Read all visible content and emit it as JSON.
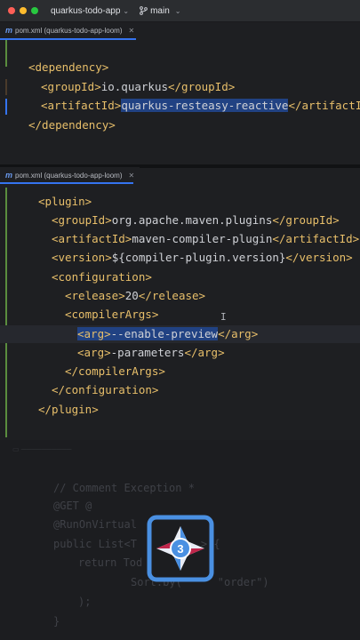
{
  "window": {
    "project": "quarkus-todo-app",
    "branch": "main",
    "traffic_lights": [
      "#ff5f57",
      "#febc2e",
      "#28c840"
    ]
  },
  "pane1": {
    "tab_label": "pom.xml (quarkus-todo-app-loom)",
    "lines": {
      "l1": "<dependency>",
      "l2_open": "<groupId>",
      "l2_val": "io.quarkus",
      "l2_close": "</groupId>",
      "l3_open": "<artifactId>",
      "l3_val": "quarkus-resteasy-reactive",
      "l3_close": "</artifactI",
      "l4": "</dependency>"
    }
  },
  "pane2": {
    "tab_label": "pom.xml (quarkus-todo-app-loom)",
    "lines": {
      "plugin_open": "<plugin>",
      "g_open": "<groupId>",
      "g_val": "org.apache.maven.plugins",
      "g_close": "</groupId>",
      "a_open": "<artifactId>",
      "a_val": "maven-compiler-plugin",
      "a_close": "</artifactId>",
      "v_open": "<version>",
      "v_val": "${compiler-plugin.version}",
      "v_close": "</version>",
      "conf_open": "<configuration>",
      "r_open": "<release>",
      "r_val": "20",
      "r_close": "</release>",
      "ca_open": "<compilerArgs>",
      "arg1_open": "<arg>",
      "arg1_val": "--enable-preview",
      "arg1_close": "</arg>",
      "arg2_open": "<arg>",
      "arg2_val": "-parameters",
      "arg2_close": "</arg>",
      "ca_close": "</compilerArgs>",
      "conf_close": "</configuration>",
      "plugin_close": "</plugin>"
    }
  },
  "background_code": {
    "l1": "// Comment Exception *",
    "l2": "@GET @",
    "l3": "@RunOnVirtual",
    "l4": "public List<T",
    "l4b": "> {",
    "l5": "return Tod",
    "l6": "Sort.by(",
    "l6b": "\"order\")",
    "l7": ");",
    "l8": "}"
  },
  "logo": {
    "badge_number": "3"
  }
}
